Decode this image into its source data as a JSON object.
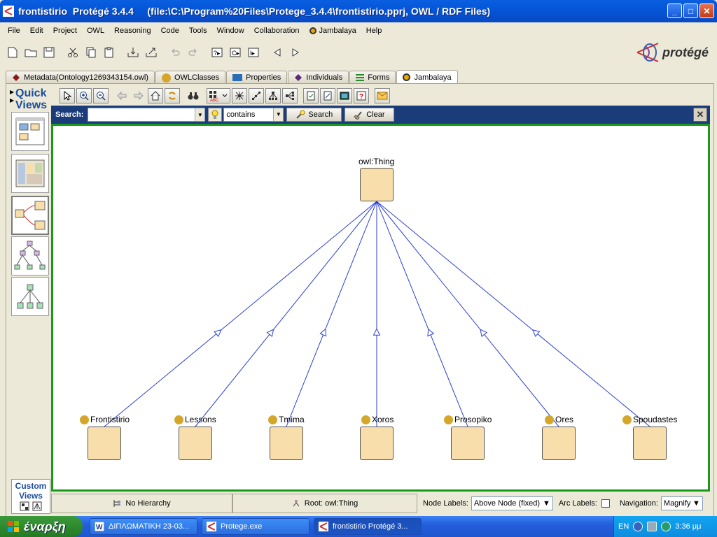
{
  "window": {
    "title": "frontistirio  Protégé 3.4.4     (file:\\C:\\Program%20Files\\Protege_3.4.4\\frontistirio.pprj, OWL / RDF Files)"
  },
  "menu": [
    "File",
    "Edit",
    "Project",
    "OWL",
    "Reasoning",
    "Code",
    "Tools",
    "Window",
    "Collaboration",
    "Jambalaya",
    "Help"
  ],
  "logo": {
    "text": "protégé"
  },
  "tabs": [
    "Metadata(Ontology1269343154.owl)",
    "OWLClasses",
    "Properties",
    "Individuals",
    "Forms",
    "Jambalaya"
  ],
  "active_tab": "Jambalaya",
  "quick_views": {
    "title_line1": "Quick",
    "title_line2": "Views"
  },
  "custom_views": {
    "line1": "Custom",
    "line2": "Views"
  },
  "search": {
    "label": "Search:",
    "value": "",
    "mode": "contains",
    "search_button": "Search",
    "clear_button": "Clear"
  },
  "graph": {
    "root": "owl:Thing",
    "children": [
      "Frontistirio",
      "Lessons",
      "Tmima",
      "Xoros",
      "Prosopiko",
      "Ores",
      "Spoudastes"
    ]
  },
  "statusbar": {
    "hierarchy": "No Hierarchy",
    "root": "Root: owl:Thing",
    "node_labels_label": "Node Labels:",
    "node_labels_value": "Above Node (fixed)",
    "arc_labels_label": "Arc Labels:",
    "navigation_label": "Navigation:",
    "navigation_value": "Magnify"
  },
  "taskbar": {
    "start": "έναρξη",
    "tasks": [
      "ΔΙΠΛΩΜΑΤΙΚΗ 23-03...",
      "Protege.exe",
      "frontistirio  Protégé 3..."
    ],
    "lang": "EN",
    "clock": "3:36 μμ"
  },
  "colors": {
    "accent": "#1a3c7a",
    "node_fill": "#f7deaa",
    "class_dot": "#d4a72c",
    "edge": "#2a3fd0",
    "canvas_border": "#1a9a1a"
  }
}
